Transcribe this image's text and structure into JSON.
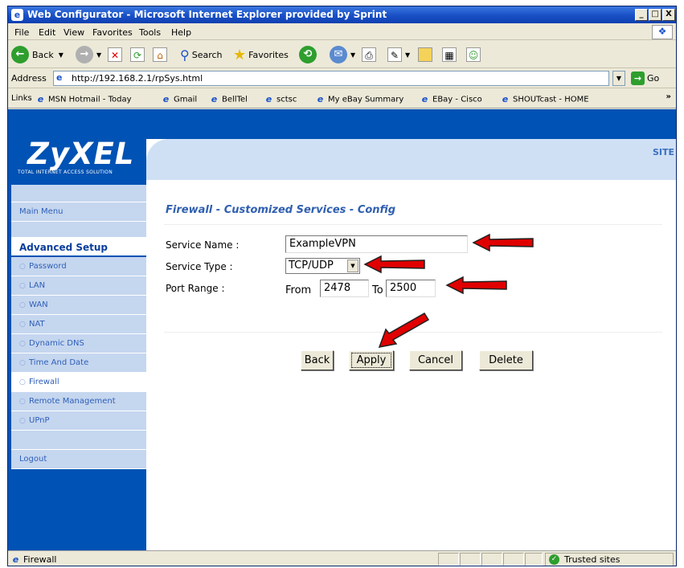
{
  "window": {
    "title": "Web Configurator - Microsoft Internet Explorer provided by Sprint",
    "controls": {
      "minimize": "_",
      "maximize": "□",
      "close": "X"
    }
  },
  "menubar": {
    "items": [
      "File",
      "Edit",
      "View",
      "Favorites",
      "Tools",
      "Help"
    ]
  },
  "toolbar": {
    "back": "Back",
    "search": "Search",
    "favorites": "Favorites"
  },
  "address": {
    "label": "Address",
    "url": "http://192.168.2.1/rpSys.html",
    "go": "Go"
  },
  "links": {
    "label": "Links",
    "items": [
      "MSN Hotmail - Today",
      "Gmail",
      "BellTel",
      "sctsc",
      "My eBay Summary",
      "EBay - Cisco",
      "SHOUTcast - HOME"
    ],
    "more": "»"
  },
  "brand": {
    "logo": "ZyXEL",
    "tagline": "TOTAL INTERNET ACCESS SOLUTION",
    "site": "SITE"
  },
  "sidebar": {
    "main_menu": "Main Menu",
    "advanced": "Advanced Setup",
    "items": [
      "Password",
      "LAN",
      "WAN",
      "NAT",
      "Dynamic DNS",
      "Time And Date",
      "Firewall",
      "Remote Management",
      "UPnP"
    ],
    "active": "Firewall",
    "logout": "Logout"
  },
  "form": {
    "title": "Firewall - Customized Services - Config",
    "service_name_label": "Service Name :",
    "service_name_value": "ExampleVPN",
    "service_type_label": "Service Type :",
    "service_type_value": "TCP/UDP",
    "port_range_label": "Port Range :",
    "from_label": "From",
    "from_value": "2478",
    "to_label": "To",
    "to_value": "2500"
  },
  "buttons": {
    "back": "Back",
    "apply": "Apply",
    "cancel": "Cancel",
    "delete": "Delete"
  },
  "statusbar": {
    "text": "Firewall",
    "zone": "Trusted sites"
  },
  "colors": {
    "brand_blue": "#0052b4",
    "arrow_red": "#e00000"
  }
}
